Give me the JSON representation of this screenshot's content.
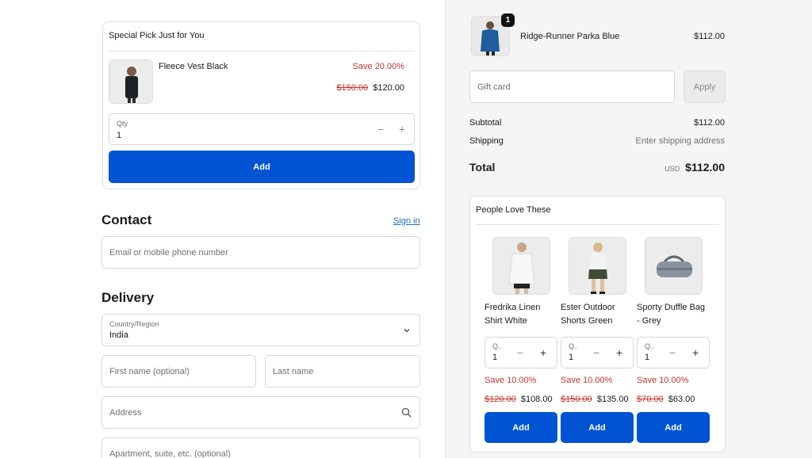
{
  "special_pick": {
    "heading": "Special Pick Just for You",
    "product_name": "Fleece Vest Black",
    "save_text": "Save 20.00%",
    "original_price": "$150.00",
    "sale_price": "$120.00",
    "qty_label": "Qty",
    "qty_value": "1",
    "add_label": "Add"
  },
  "contact": {
    "title": "Contact",
    "sign_in": "Sign in",
    "email_placeholder": "Email or mobile phone number"
  },
  "delivery": {
    "title": "Delivery",
    "country_label": "Country/Region",
    "country_value": "India",
    "first_name_placeholder": "First name (optional)",
    "last_name_placeholder": "Last name",
    "address_placeholder": "Address",
    "apartment_placeholder": "Apartment, suite, etc. (optional)"
  },
  "summary": {
    "item_name": "Ridge-Runner Parka Blue",
    "item_price": "$112.00",
    "item_qty_badge": "1",
    "gift_card_placeholder": "Gift card",
    "apply_label": "Apply",
    "subtotal_label": "Subtotal",
    "subtotal_value": "$112.00",
    "shipping_label": "Shipping",
    "shipping_value": "Enter shipping address",
    "total_label": "Total",
    "currency": "USD",
    "total_value": "$112.00"
  },
  "people_love": {
    "heading": "People Love These",
    "items": [
      {
        "name_line1": "Fredrika Linen",
        "name_line2": "Shirt White",
        "qty_label": "Q..",
        "qty_value": "1",
        "save_text": "Save 10.00%",
        "original_price": "$120.00",
        "sale_price": "$108.00",
        "add_label": "Add"
      },
      {
        "name_line1": "Ester Outdoor",
        "name_line2": "Shorts Green",
        "qty_label": "Q..",
        "qty_value": "1",
        "save_text": "Save 10.00%",
        "original_price": "$150.00",
        "sale_price": "$135.00",
        "add_label": "Add"
      },
      {
        "name_line1": "Sporty Duffle Bag",
        "name_line2": "- Grey",
        "qty_label": "Q..",
        "qty_value": "1",
        "save_text": "Save 10.00%",
        "original_price": "$70.00",
        "sale_price": "$63.00",
        "add_label": "Add"
      }
    ]
  },
  "colors": {
    "accent": "#0054d3",
    "sale_red": "#c4362e",
    "link": "#1f6fb5"
  }
}
